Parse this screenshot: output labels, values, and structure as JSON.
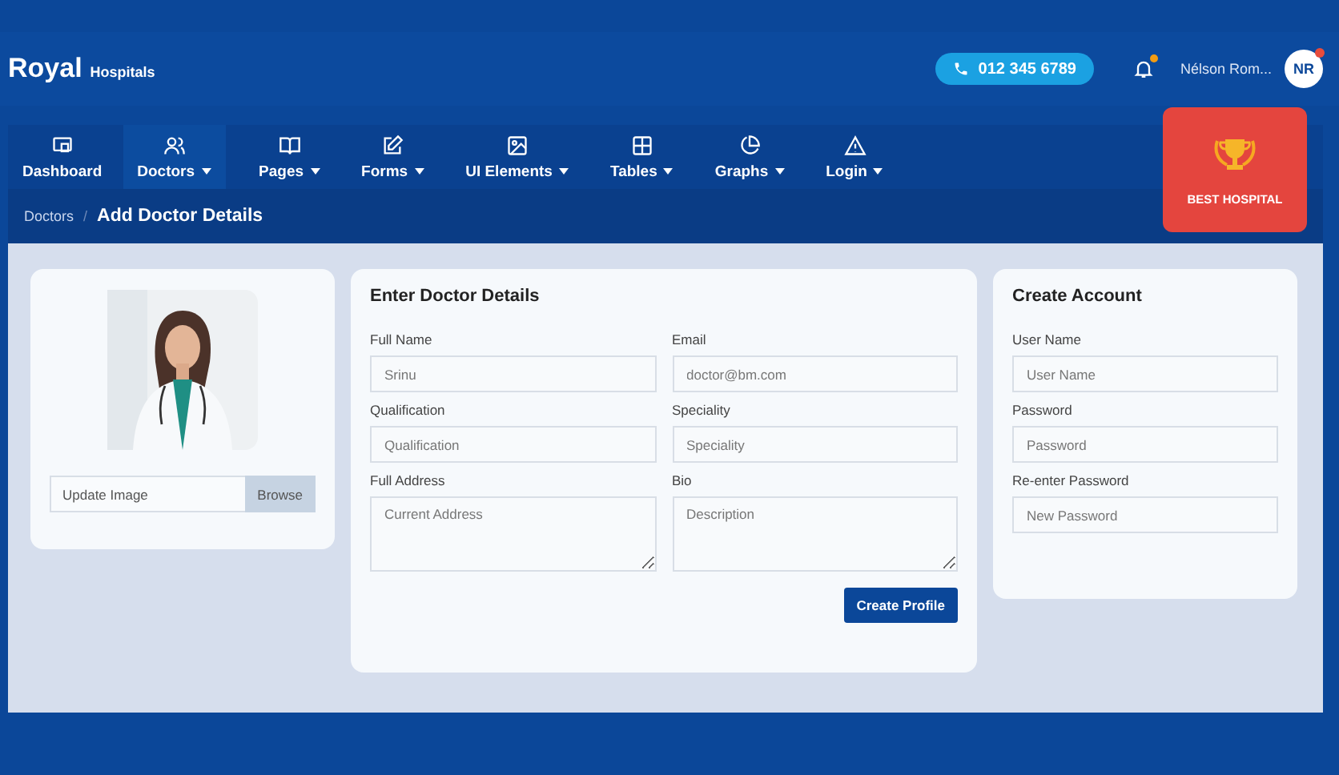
{
  "brand": {
    "name": "Royal",
    "sub": "Hospitals"
  },
  "phone": "012 345 6789",
  "notifications": {
    "unread": true
  },
  "user": {
    "name": "Nélson Rom...",
    "initials": "NR",
    "online": true
  },
  "nav": [
    {
      "label": "Dashboard",
      "dropdown": false,
      "selected": false
    },
    {
      "label": "Doctors",
      "dropdown": true,
      "selected": true
    },
    {
      "label": "Pages",
      "dropdown": true,
      "selected": false
    },
    {
      "label": "Forms",
      "dropdown": true,
      "selected": false
    },
    {
      "label": "UI Elements",
      "dropdown": true,
      "selected": false
    },
    {
      "label": "Tables",
      "dropdown": true,
      "selected": false
    },
    {
      "label": "Graphs",
      "dropdown": true,
      "selected": false
    },
    {
      "label": "Login",
      "dropdown": true,
      "selected": false
    }
  ],
  "award": {
    "label": "BEST HOSPITAL"
  },
  "breadcrumb": {
    "parent": "Doctors",
    "separator": "/",
    "current": "Add Doctor Details"
  },
  "photo_card": {
    "file_placeholder": "Update Image",
    "browse": "Browse"
  },
  "details": {
    "title": "Enter Doctor Details",
    "fields": [
      {
        "label": "Full Name",
        "placeholder": "Srinu",
        "kind": "input"
      },
      {
        "label": "Email",
        "placeholder": "doctor@bm.com",
        "kind": "input"
      },
      {
        "label": "Qualification",
        "placeholder": "Qualification",
        "kind": "input"
      },
      {
        "label": "Speciality",
        "placeholder": "Speciality",
        "kind": "input"
      },
      {
        "label": "Full Address",
        "placeholder": "Current Address",
        "kind": "textarea"
      },
      {
        "label": "Bio",
        "placeholder": "Description",
        "kind": "textarea"
      }
    ],
    "button": "Create Profile"
  },
  "account": {
    "title": "Create Account",
    "fields": [
      {
        "label": "User Name",
        "placeholder": "User Name"
      },
      {
        "label": "Password",
        "placeholder": "Password"
      },
      {
        "label": "Re-enter Password",
        "placeholder": "New Password"
      }
    ]
  }
}
